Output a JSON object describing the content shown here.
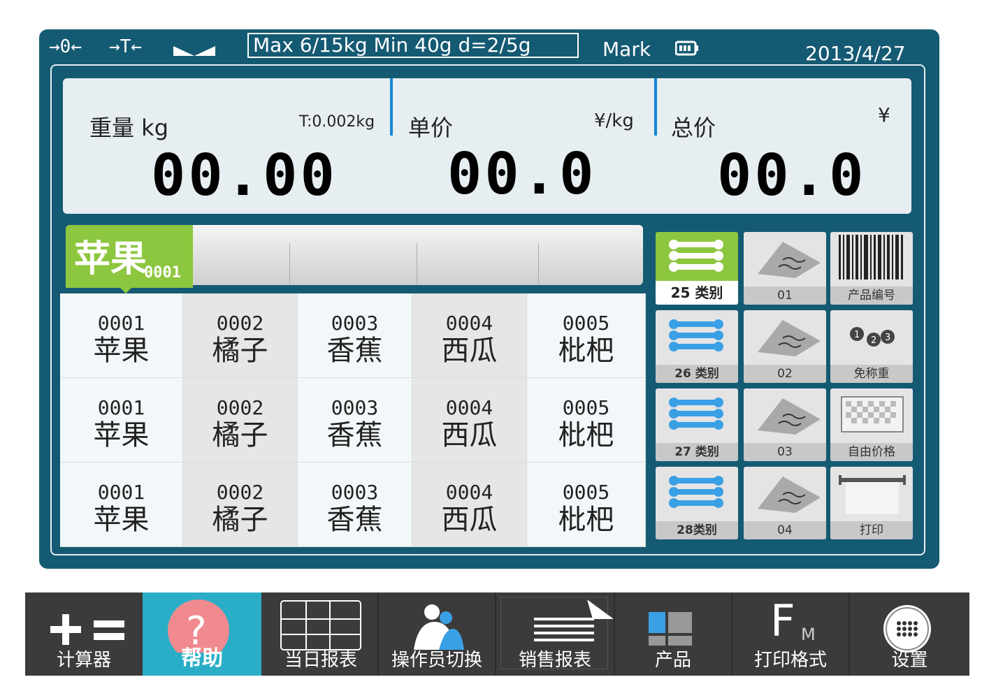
{
  "status": {
    "zero_symbol": "→0←",
    "tare_symbol": "→T←",
    "stable_icon": "stable-icon",
    "spec": "Max 6/15kg  Min 40g  d=2/5g",
    "mark": "Mark",
    "battery_icon": "battery-icon",
    "date": "2013/4/27"
  },
  "lcd": {
    "weight": {
      "label": "重量  kg",
      "tare": "T:0.002kg",
      "value": "00.00"
    },
    "unit_price": {
      "label": "单价",
      "unit": "¥/kg",
      "value": "00.0"
    },
    "total": {
      "label": "总价",
      "unit": "¥",
      "value": "00.0"
    }
  },
  "selected_product": {
    "name": "苹果",
    "code": "0001"
  },
  "products": [
    [
      {
        "code": "0001",
        "name": "苹果"
      },
      {
        "code": "0002",
        "name": "橘子"
      },
      {
        "code": "0003",
        "name": "香蕉"
      },
      {
        "code": "0004",
        "name": "西瓜"
      },
      {
        "code": "0005",
        "name": "枇杷"
      }
    ],
    [
      {
        "code": "0001",
        "name": "苹果"
      },
      {
        "code": "0002",
        "name": "橘子"
      },
      {
        "code": "0003",
        "name": "香蕉"
      },
      {
        "code": "0004",
        "name": "西瓜"
      },
      {
        "code": "0005",
        "name": "枇杷"
      }
    ],
    [
      {
        "code": "0001",
        "name": "苹果"
      },
      {
        "code": "0002",
        "name": "橘子"
      },
      {
        "code": "0003",
        "name": "香蕉"
      },
      {
        "code": "0004",
        "name": "西瓜"
      },
      {
        "code": "0005",
        "name": "枇杷"
      }
    ]
  ],
  "side_buttons": {
    "categories": [
      "25 类别",
      "26 类别",
      "27 类别",
      "28类别"
    ],
    "counters": [
      "01",
      "02",
      "03",
      "04"
    ],
    "functions": [
      "产品编号",
      "免称重",
      "自由价格",
      "打印"
    ]
  },
  "toolbar": {
    "calculator": "计算器",
    "help": "帮助",
    "help_symbol": "?",
    "daily_report": "当日报表",
    "operator_switch": "操作员切换",
    "sales_report": "销售报表",
    "products": "产品",
    "print_format": "打印格式",
    "print_format_f": "F",
    "print_format_m": "M",
    "settings": "设置"
  },
  "colors": {
    "panel": "#155a73",
    "accent_green": "#8dc63f",
    "lcd_bg": "#e7eef2",
    "separator_blue": "#1686d6",
    "toolbar_bg": "#3b3b3b",
    "help_bg": "#2aaec7",
    "help_circle": "#f08a8f"
  }
}
